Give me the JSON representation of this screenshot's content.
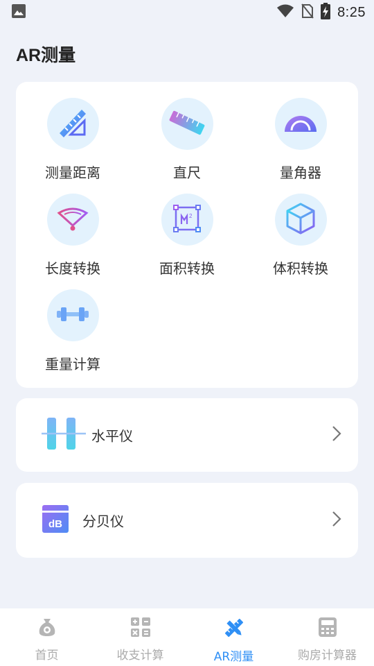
{
  "status_bar": {
    "time": "8:25",
    "icons": [
      "image-icon",
      "wifi-icon",
      "no-sim-icon",
      "battery-charging-icon"
    ]
  },
  "page": {
    "title": "AR测量"
  },
  "tools": [
    {
      "label": "测量距离",
      "icon": "ruler-triangle-icon"
    },
    {
      "label": "直尺",
      "icon": "ruler-icon"
    },
    {
      "label": "量角器",
      "icon": "protractor-icon"
    },
    {
      "label": "长度转换",
      "icon": "fan-icon"
    },
    {
      "label": "面积转换",
      "icon": "area-square-icon"
    },
    {
      "label": "体积转换",
      "icon": "cube-icon"
    },
    {
      "label": "重量计算",
      "icon": "dumbbell-icon"
    }
  ],
  "rows": [
    {
      "label": "水平仪",
      "icon": "level-icon"
    },
    {
      "label": "分贝仪",
      "icon": "decibel-icon",
      "icon_text": "dB"
    }
  ],
  "bottom_nav": [
    {
      "label": "首页",
      "icon": "money-bag-icon",
      "active": false
    },
    {
      "label": "收支计算",
      "icon": "calculator-grid-icon",
      "active": false
    },
    {
      "label": "AR测量",
      "icon": "ruler-pencil-icon",
      "active": true
    },
    {
      "label": "购房计算器",
      "icon": "calculator-icon",
      "active": false
    }
  ],
  "colors": {
    "background": "#eff2f9",
    "accent": "#2f8ff5",
    "icon_circle": "#e3f2fd"
  }
}
